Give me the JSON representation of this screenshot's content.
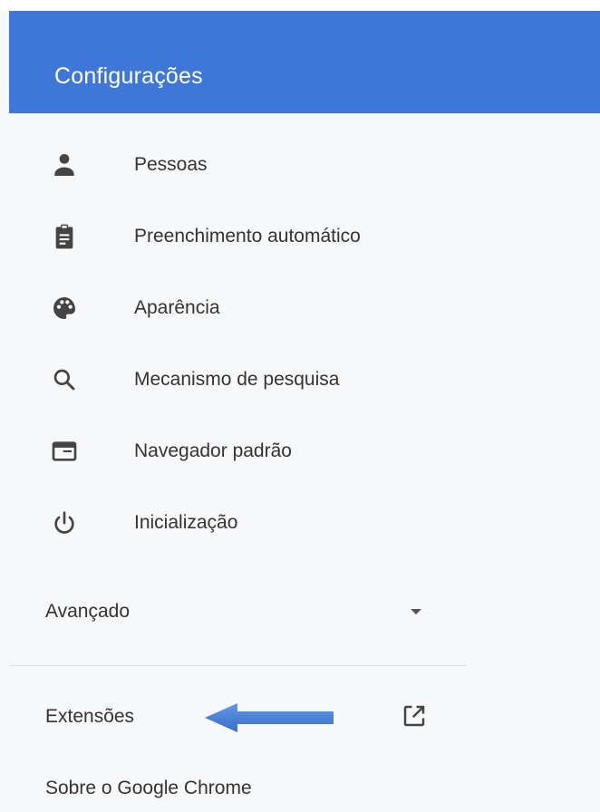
{
  "header": {
    "title": "Configurações",
    "background_color": "#3f77d9"
  },
  "nav": {
    "items": [
      {
        "label": "Pessoas",
        "icon": "person-icon"
      },
      {
        "label": "Preenchimento automático",
        "icon": "clipboard-icon"
      },
      {
        "label": "Aparência",
        "icon": "palette-icon"
      },
      {
        "label": "Mecanismo de pesquisa",
        "icon": "search-icon"
      },
      {
        "label": "Navegador padrão",
        "icon": "browser-window-icon"
      },
      {
        "label": "Inicialização",
        "icon": "power-icon"
      }
    ]
  },
  "advanced": {
    "label": "Avançado",
    "icon": "chevron-down-icon"
  },
  "extensions": {
    "label": "Extensões",
    "icon": "open-in-new-icon"
  },
  "about": {
    "label": "Sobre o Google Chrome"
  },
  "annotation": {
    "icon": "blue-arrow-icon",
    "color": "#3d7ad6"
  },
  "colors": {
    "background": "#f7f8fa",
    "text": "#333333",
    "icon": "#444444"
  }
}
